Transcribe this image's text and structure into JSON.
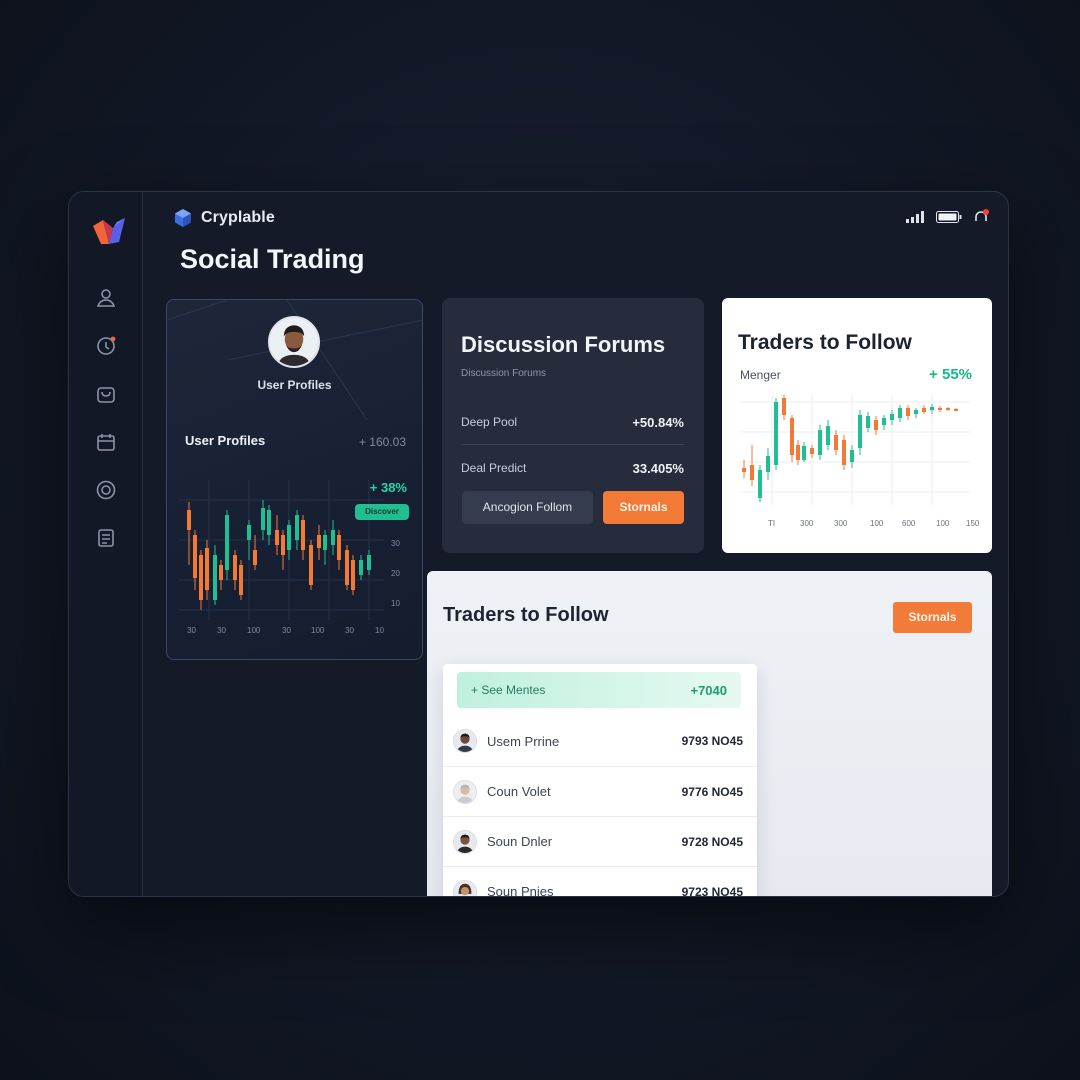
{
  "app": {
    "brand": "Cryplable",
    "page_title": "Social Trading"
  },
  "sidebar": {
    "items": [
      {
        "icon": "user-icon"
      },
      {
        "icon": "clock-icon"
      },
      {
        "icon": "bag-icon"
      },
      {
        "icon": "calendar-icon"
      },
      {
        "icon": "target-icon"
      },
      {
        "icon": "document-icon"
      }
    ]
  },
  "profile_card": {
    "top_label": "User Profiles",
    "section_label": "User Profiles",
    "count": "+ 160.03",
    "change": "+ 38%",
    "badge": "Discover",
    "x_ticks": [
      "30",
      "30",
      "100",
      "30",
      "100",
      "30",
      "10"
    ],
    "y_ticks": [
      "30",
      "20",
      "10"
    ]
  },
  "discussion": {
    "title": "Discussion Forums",
    "subtitle": "Discussion Forums",
    "rows": [
      {
        "label": "Deep Pool",
        "value": "+50.84%"
      },
      {
        "label": "Deal Predict",
        "value": "33.405%"
      }
    ],
    "secondary_button": "Ancogion Follom",
    "primary_button": "Stornals"
  },
  "traders_chart": {
    "title": "Traders to Follow",
    "subtitle": "Menger",
    "change": "+ 55%",
    "x_ticks": [
      "TI",
      "300",
      "300",
      "100",
      "600",
      "100",
      "150"
    ],
    "accent_up": "#1fbf92",
    "accent_down": "#f27a36"
  },
  "traders_list": {
    "title": "Traders to Follow",
    "button": "Stornals",
    "highlight": {
      "label": "+ See Mentes",
      "value": "+7040"
    },
    "rows": [
      {
        "name": "Usem Prrine",
        "value": "9793 NO45"
      },
      {
        "name": "Coun Volet",
        "value": "9776 NO45"
      },
      {
        "name": "Soun Dnler",
        "value": "9728 NO45"
      },
      {
        "name": "Soun Pnies",
        "value": "9723 NO45"
      }
    ]
  },
  "colors": {
    "accent_orange": "#f27a36",
    "accent_green": "#1fbf92",
    "panel_dark": "#262c3b",
    "background": "#121826"
  }
}
